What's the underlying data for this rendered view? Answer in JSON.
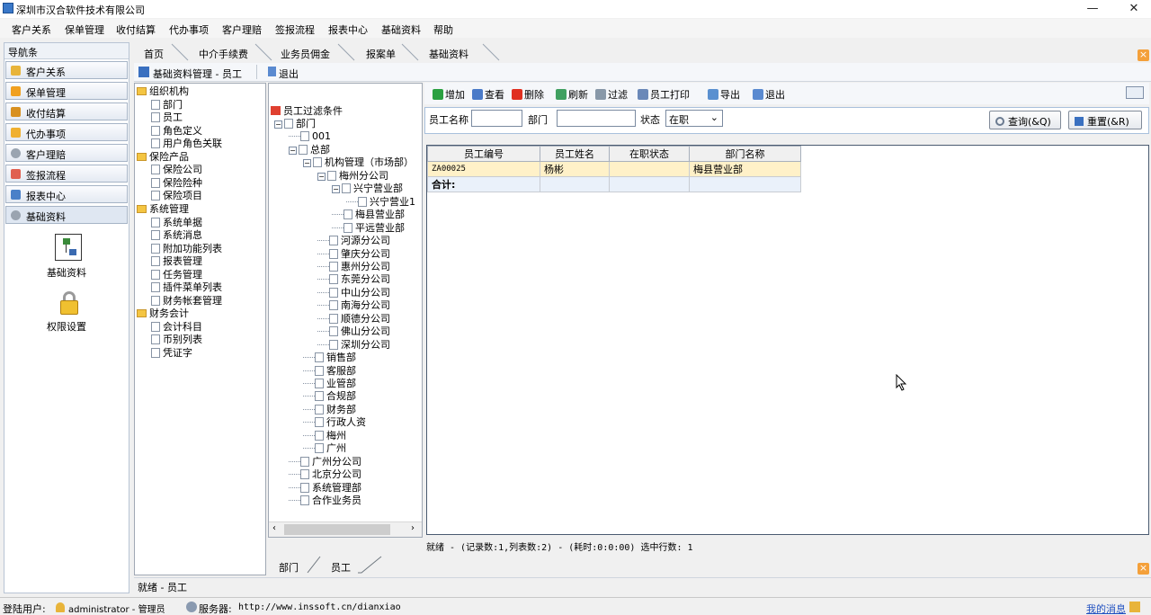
{
  "window": {
    "title": "深圳市汉合软件技术有限公司",
    "minimize": "—",
    "maximize": "❐",
    "close": "✕"
  },
  "menu": [
    "客户关系",
    "保单管理",
    "收付结算",
    "代办事项",
    "客户理赔",
    "签报流程",
    "报表中心",
    "基础资料",
    "帮助"
  ],
  "nav": {
    "header": "导航条",
    "items": [
      "客户关系",
      "保单管理",
      "收付结算",
      "代办事项",
      "客户理赔",
      "签报流程",
      "报表中心",
      "基础资料"
    ],
    "big_items": [
      "基础资料",
      "权限设置"
    ]
  },
  "tabs": [
    "首页",
    "中介手续费",
    "业务员佣金",
    "报案单",
    "基础资料"
  ],
  "toolbar1": {
    "title": "基础资料管理 - 员工",
    "exit": "退出"
  },
  "left_tree": [
    {
      "label": "组织机构",
      "type": "folder",
      "level": 0
    },
    {
      "label": "部门",
      "type": "doc",
      "level": 1
    },
    {
      "label": "员工",
      "type": "doc",
      "level": 1
    },
    {
      "label": "角色定义",
      "type": "doc",
      "level": 1
    },
    {
      "label": "用户角色关联",
      "type": "doc",
      "level": 1
    },
    {
      "label": "保险产品",
      "type": "folder",
      "level": 0
    },
    {
      "label": "保险公司",
      "type": "doc",
      "level": 1
    },
    {
      "label": "保险险种",
      "type": "doc",
      "level": 1
    },
    {
      "label": "保险项目",
      "type": "doc",
      "level": 1
    },
    {
      "label": "系统管理",
      "type": "folder",
      "level": 0
    },
    {
      "label": "系统单据",
      "type": "doc",
      "level": 1
    },
    {
      "label": "系统消息",
      "type": "doc",
      "level": 1
    },
    {
      "label": "附加功能列表",
      "type": "doc",
      "level": 1
    },
    {
      "label": "报表管理",
      "type": "doc",
      "level": 1
    },
    {
      "label": "任务管理",
      "type": "doc",
      "level": 1
    },
    {
      "label": "插件菜单列表",
      "type": "doc",
      "level": 1
    },
    {
      "label": "财务帐套管理",
      "type": "doc",
      "level": 1
    },
    {
      "label": "财务会计",
      "type": "folder",
      "level": 0
    },
    {
      "label": "会计科目",
      "type": "doc",
      "level": 1
    },
    {
      "label": "币别列表",
      "type": "doc",
      "level": 1
    },
    {
      "label": "凭证字",
      "type": "doc",
      "level": 1
    }
  ],
  "mid_tree": {
    "root": "员工过滤条件",
    "nodes": [
      {
        "label": "部门",
        "level": 0,
        "box": "⊟"
      },
      {
        "label": "001",
        "level": 1,
        "box": ""
      },
      {
        "label": "总部",
        "level": 1,
        "box": "⊟"
      },
      {
        "label": "机构管理（市场部）",
        "level": 2,
        "box": "⊟"
      },
      {
        "label": "梅州分公司",
        "level": 3,
        "box": "⊟"
      },
      {
        "label": "兴宁营业部",
        "level": 4,
        "box": "⊟"
      },
      {
        "label": "兴宁营业1",
        "level": 5,
        "box": ""
      },
      {
        "label": "梅县营业部",
        "level": 4,
        "box": ""
      },
      {
        "label": "平远营业部",
        "level": 4,
        "box": ""
      },
      {
        "label": "河源分公司",
        "level": 3,
        "box": ""
      },
      {
        "label": "肇庆分公司",
        "level": 3,
        "box": ""
      },
      {
        "label": "惠州分公司",
        "level": 3,
        "box": ""
      },
      {
        "label": "东莞分公司",
        "level": 3,
        "box": ""
      },
      {
        "label": "中山分公司",
        "level": 3,
        "box": ""
      },
      {
        "label": "南海分公司",
        "level": 3,
        "box": ""
      },
      {
        "label": "顺德分公司",
        "level": 3,
        "box": ""
      },
      {
        "label": "佛山分公司",
        "level": 3,
        "box": ""
      },
      {
        "label": "深圳分公司",
        "level": 3,
        "box": ""
      },
      {
        "label": "销售部",
        "level": 2,
        "box": ""
      },
      {
        "label": "客服部",
        "level": 2,
        "box": ""
      },
      {
        "label": "业管部",
        "level": 2,
        "box": ""
      },
      {
        "label": "合规部",
        "level": 2,
        "box": ""
      },
      {
        "label": "财务部",
        "level": 2,
        "box": ""
      },
      {
        "label": "行政人资",
        "level": 2,
        "box": ""
      },
      {
        "label": "梅州",
        "level": 2,
        "box": ""
      },
      {
        "label": "广州",
        "level": 2,
        "box": ""
      },
      {
        "label": "广州分公司",
        "level": 1,
        "box": ""
      },
      {
        "label": "北京分公司",
        "level": 1,
        "box": ""
      },
      {
        "label": "系统管理部",
        "level": 1,
        "box": ""
      },
      {
        "label": "合作业务员",
        "level": 1,
        "box": ""
      }
    ],
    "bottom_tabs": [
      "部门",
      "员工"
    ]
  },
  "toolbar2": [
    "增加",
    "查看",
    "删除",
    "刷新",
    "过滤",
    "员工打印",
    "导出",
    "退出"
  ],
  "filter": {
    "name_label": "员工名称",
    "name_value": "",
    "dept_label": "部门",
    "dept_value": "",
    "status_label": "状态",
    "status_value": "在职",
    "query_button": "查询(&Q)",
    "reset_button": "重置(&R)"
  },
  "grid": {
    "columns": [
      "员工编号",
      "员工姓名",
      "在职状态",
      "部门名称"
    ],
    "rows": [
      [
        "ZA00025",
        "杨彬",
        "",
        "梅县营业部"
      ]
    ],
    "total_label": "合计:",
    "status": "就绪 - (记录数:1,列表数:2) - (耗时:0:0:00) 选中行数: 1"
  },
  "panel_status": "就绪 - 员工",
  "statusbar": {
    "user_label": "登陆用户:",
    "user_value": "administrator - 管理员",
    "server_label": "服务器:",
    "server_value": "http://www.inssoft.cn/dianxiao",
    "messages": "我的消息"
  },
  "colors": {
    "accent": "#f4a03a",
    "selected_row": "#fff1c8",
    "folder": "#f4c542"
  }
}
